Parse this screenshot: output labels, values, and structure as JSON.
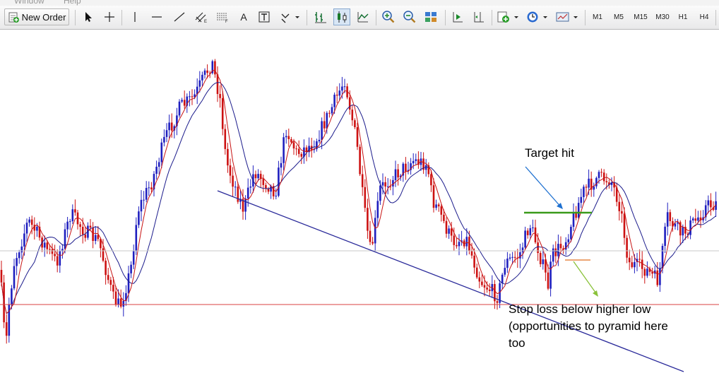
{
  "menu": {
    "items": [
      "Window",
      "Help"
    ]
  },
  "toolbar": {
    "new_order_label": "New Order",
    "text_tool_label": "A",
    "timeframes": [
      "M1",
      "M5",
      "M15",
      "M30",
      "H1",
      "H4"
    ]
  },
  "annotations": {
    "target": "Target hit",
    "stop_line1": "Stop loss below higher low",
    "stop_line2": "(opportunities to pyramid here",
    "stop_line3": "too"
  },
  "colors": {
    "bull_candle": "#1f1fbf",
    "bear_candle": "#cc1111",
    "fast_ma": "#c81414",
    "slow_ma": "#1c1c8c",
    "trendline": "#2a2a9a",
    "support_line": "#d84040",
    "target_line": "#3a9a1a",
    "stop_marker": "#e07020",
    "target_arrow": "#1e70d0",
    "stop_arrow": "#8ac23a"
  }
}
